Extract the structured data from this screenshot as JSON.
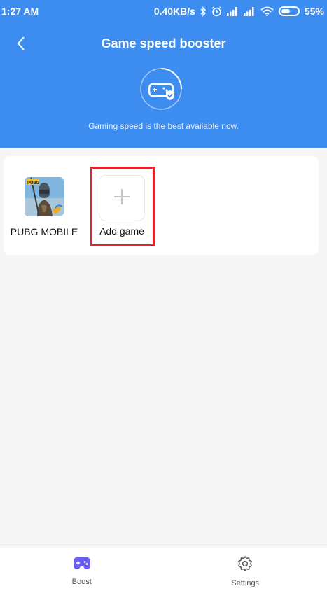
{
  "status_bar": {
    "time": "1:27 AM",
    "network_speed": "0.40KB/s",
    "battery_percent": "55%",
    "battery_level": 0.55,
    "icons": [
      "bluetooth-icon",
      "alarm-icon",
      "signal-icon",
      "signal-icon",
      "wifi-icon",
      "battery-icon"
    ]
  },
  "header": {
    "title": "Game speed booster",
    "subtitle": "Gaming speed is the best available now.",
    "back_icon": "chevron-left-icon",
    "hero_icon": "gamepad-shield-icon",
    "background_color": "#3d8cf0"
  },
  "games": {
    "items": [
      {
        "label": "PUBG MOBILE",
        "icon": "pubg-mobile-app-icon"
      },
      {
        "label": "Add game",
        "icon": "plus-icon"
      }
    ],
    "highlight_color": "#e0232c"
  },
  "bottom_nav": {
    "items": [
      {
        "label": "Boost",
        "icon": "gamepad-icon",
        "active": true,
        "color": "#6b5cf0"
      },
      {
        "label": "Settings",
        "icon": "gear-icon",
        "active": false,
        "color": "#555555"
      }
    ]
  }
}
